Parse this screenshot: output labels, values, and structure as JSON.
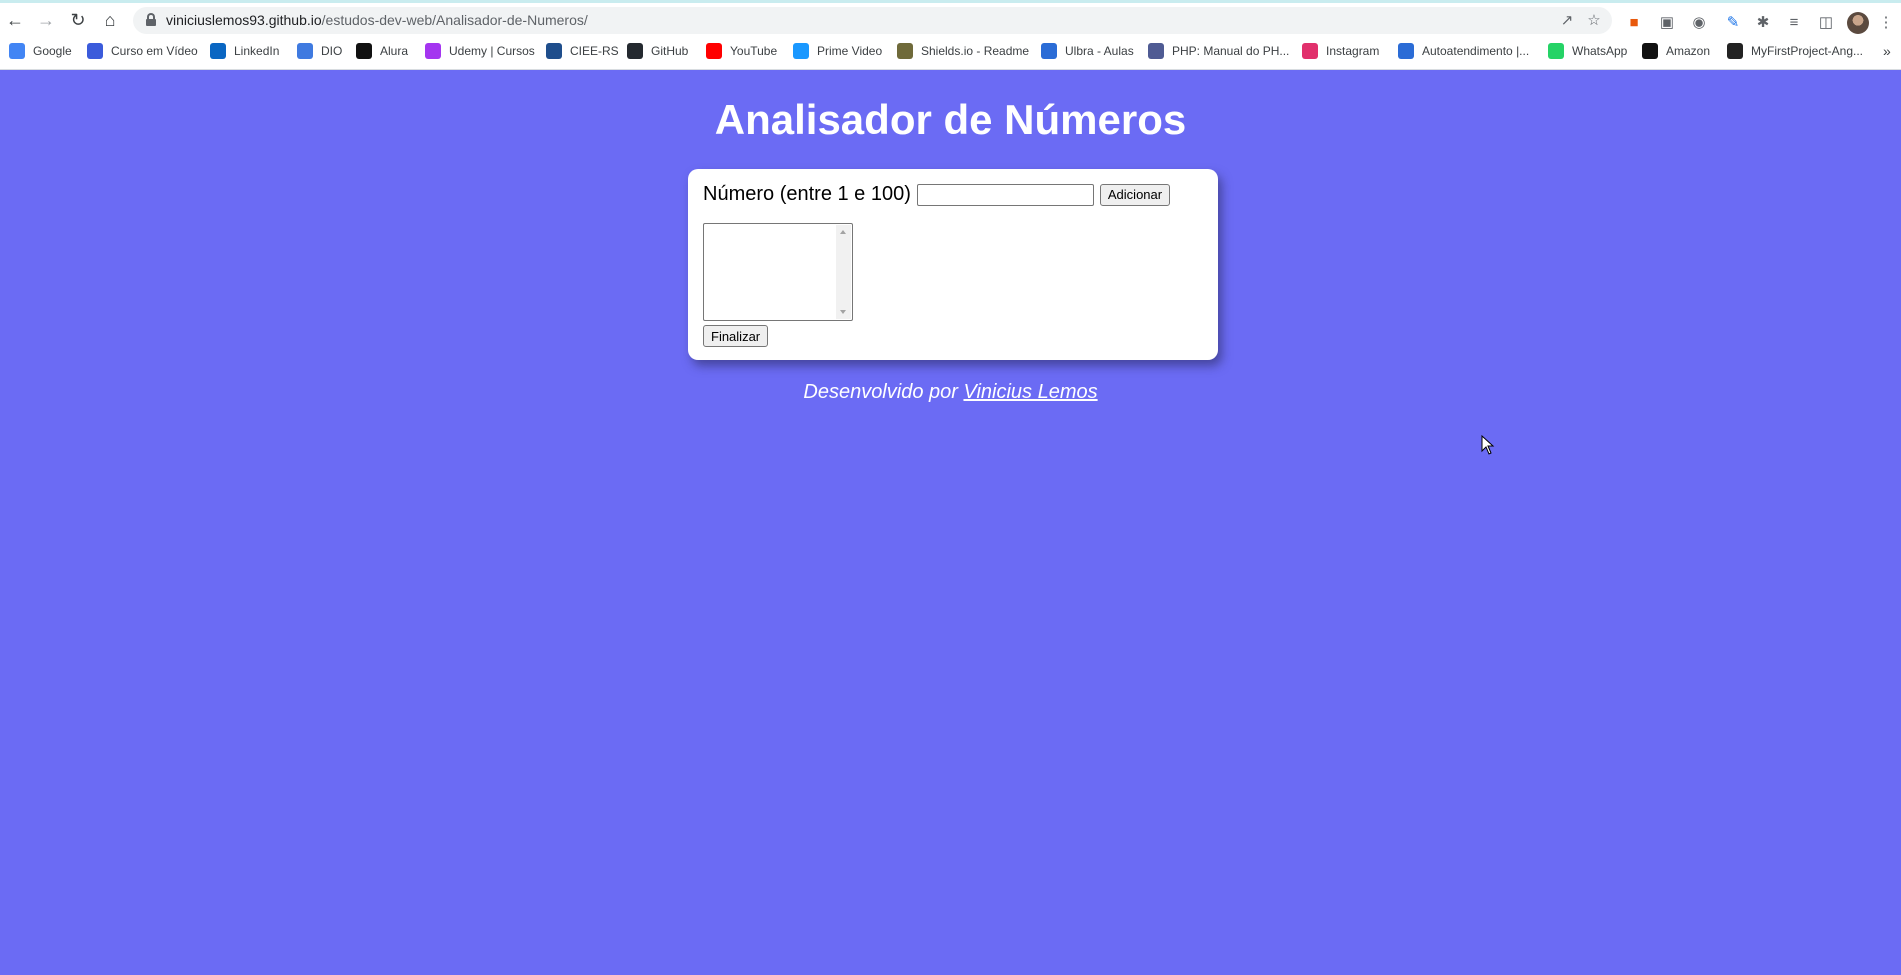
{
  "browser": {
    "url_host": "viniciuslemos93.github.io",
    "url_path": "/estudos-dev-web/Analisador-de-Numeros/",
    "nav": {
      "back_icon": "arrow-left-icon",
      "forward_icon": "arrow-right-icon",
      "reload_icon": "reload-icon",
      "home_icon": "home-icon"
    },
    "bookmarks": [
      {
        "label": "Google",
        "icon": "google-icon",
        "color": "#4285f4"
      },
      {
        "label": "Curso em Vídeo",
        "icon": "curso-em-video-icon",
        "color": "#3b5bdb"
      },
      {
        "label": "LinkedIn",
        "icon": "linkedin-icon",
        "color": "#0a66c2"
      },
      {
        "label": "DIO",
        "icon": "dio-icon",
        "color": "#3f7ae0"
      },
      {
        "label": "Alura",
        "icon": "alura-icon",
        "color": "#111111"
      },
      {
        "label": "Udemy | Cursos",
        "icon": "udemy-icon",
        "color": "#a435f0"
      },
      {
        "label": "CIEE-RS",
        "icon": "ciee-icon",
        "color": "#1f4e8c"
      },
      {
        "label": "GitHub",
        "icon": "github-icon",
        "color": "#24292f"
      },
      {
        "label": "YouTube",
        "icon": "youtube-icon",
        "color": "#ff0000"
      },
      {
        "label": "Prime Video",
        "icon": "prime-video-icon",
        "color": "#1a98ff"
      },
      {
        "label": "Shields.io - Readme",
        "icon": "shields-icon",
        "color": "#6f6a3a"
      },
      {
        "label": "Ulbra - Aulas",
        "icon": "ulbra-icon",
        "color": "#2b6cd6"
      },
      {
        "label": "PHP: Manual do PH...",
        "icon": "php-icon",
        "color": "#4f5b93"
      },
      {
        "label": "Instagram",
        "icon": "instagram-icon",
        "color": "#e1306c"
      },
      {
        "label": "Autoatendimento |...",
        "icon": "autoatendimento-icon",
        "color": "#2b6cd6"
      },
      {
        "label": "WhatsApp",
        "icon": "whatsapp-icon",
        "color": "#25d366"
      },
      {
        "label": "Amazon",
        "icon": "amazon-icon",
        "color": "#111111"
      },
      {
        "label": "MyFirstProject-Ang...",
        "icon": "angular-icon",
        "color": "#222222"
      }
    ],
    "more_bookmarks": "»"
  },
  "page": {
    "title": "Analisador de Números",
    "background_color": "#6b6bf4",
    "form": {
      "number_label": "Número (entre 1 e 100)",
      "number_value": "",
      "add_button": "Adicionar",
      "list_items": [],
      "finish_button": "Finalizar"
    },
    "footer": {
      "prefix": "Desenvolvido por",
      "author_link": "Vinicius Lemos"
    }
  }
}
